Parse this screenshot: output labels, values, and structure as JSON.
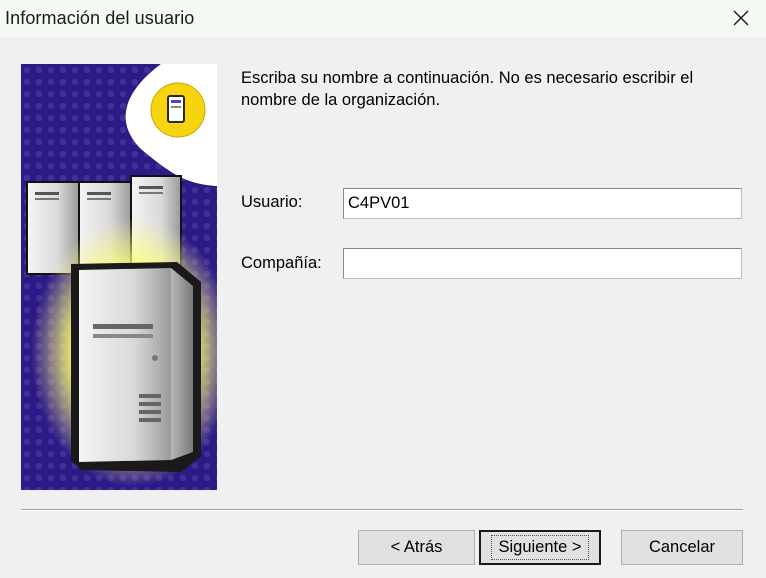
{
  "window": {
    "title": "Información del usuario",
    "close_icon": "close-icon"
  },
  "instruction": "Escriba su nombre a continuación. No es necesario escribir el nombre de la organización.",
  "form": {
    "user_label": "Usuario:",
    "user_value": "C4PV01",
    "company_label": "Compañía:",
    "company_value": ""
  },
  "buttons": {
    "back_label": "< Atrás",
    "next_label": "Siguiente >",
    "cancel_label": "Cancelar"
  },
  "illustration": {
    "icon": "server-illustration",
    "badge_icon": "computer-badge-icon"
  }
}
